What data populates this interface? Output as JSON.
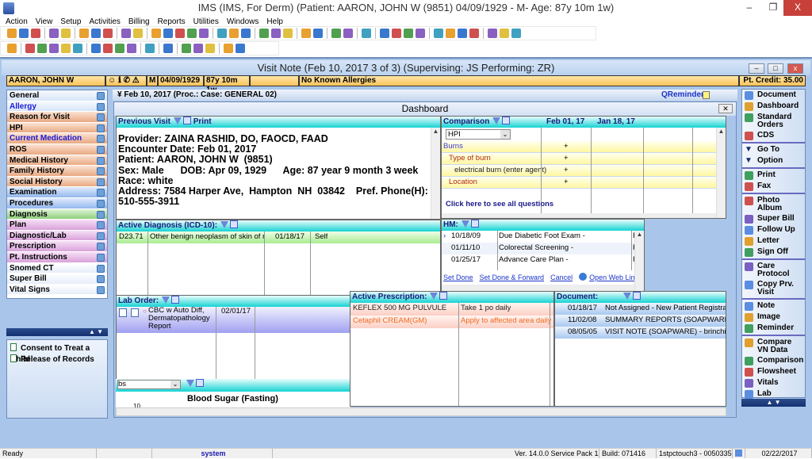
{
  "window": {
    "title": "IMS (IMS, For Derm)    (Patient: AARON, JOHN W (9851) 04/09/1929 - M- Age: 87y 10m 1w)",
    "minimize": "–",
    "restore": "❐",
    "close": "X"
  },
  "menu": [
    "Action",
    "View",
    "Setup",
    "Activities",
    "Billing",
    "Reports",
    "Utilities",
    "Windows",
    "Help"
  ],
  "toolbar1_icons": [
    "patient",
    "user",
    "user2",
    "|",
    "folder",
    "edit",
    "|",
    "lab",
    "flask",
    "shield",
    "|",
    "calendar",
    "notes",
    "|",
    "dollar",
    "refresh",
    "chart",
    "users",
    "globe",
    "|",
    "grid",
    "tools",
    "doc",
    "|",
    "arrow",
    "globe2",
    "globe3",
    "|",
    "folder2",
    "folder3",
    "|",
    "chart2",
    "person",
    "|",
    "clipboard",
    "|",
    "ins",
    "exchange",
    "word",
    "doc2",
    "|",
    "calc",
    "camera",
    "disc",
    "page",
    "|",
    "help",
    "lock",
    "exit"
  ],
  "toolbar2_icons": [
    "folder",
    "|",
    "plus",
    "edit",
    "minus",
    "pen",
    "heart",
    "|",
    "first",
    "prev",
    "next",
    "last",
    "|",
    "refresh",
    "|",
    "copy",
    "|",
    "check",
    "photo",
    "settings",
    "|",
    "help",
    "close"
  ],
  "visit_note": {
    "title": "Visit Note (Feb 10, 2017   3 of 3) (Supervising: JS Performing: ZR)"
  },
  "patient_bar": {
    "name": "AARON, JOHN W",
    "sex": "M",
    "dob": "04/09/1929",
    "age": "87y 10m 1w",
    "blank": "",
    "allergies": "No Known Allergies",
    "credit": "Pt. Credit: 35.00"
  },
  "left_nav": {
    "items": [
      {
        "label": "General",
        "group": "blue",
        "color": "#000000"
      },
      {
        "label": "Allergy",
        "group": "blue",
        "color": "#1a1ad8"
      },
      {
        "label": "Reason for Visit",
        "group": "orange",
        "color": "#000000"
      },
      {
        "label": "HPI",
        "group": "orange",
        "color": "#000000"
      },
      {
        "label": "Current Medication",
        "group": "orange",
        "color": "#1a1ad8"
      },
      {
        "label": "ROS",
        "group": "orange",
        "color": "#000000"
      },
      {
        "label": "Medical History",
        "group": "orange",
        "color": "#000000"
      },
      {
        "label": "Family History",
        "group": "orange",
        "color": "#000000"
      },
      {
        "label": "Social History",
        "group": "orange",
        "color": "#000000"
      },
      {
        "label": "Examination",
        "group": "exam",
        "color": "#000000"
      },
      {
        "label": "Procedures",
        "group": "exam",
        "color": "#000000"
      },
      {
        "label": "Diagnosis",
        "group": "green",
        "color": "#000000"
      },
      {
        "label": "Plan",
        "group": "pink",
        "color": "#000000"
      },
      {
        "label": "Diagnostic/Lab",
        "group": "pink",
        "color": "#000000"
      },
      {
        "label": "Prescription",
        "group": "pink",
        "color": "#000000"
      },
      {
        "label": "Pt. Instructions",
        "group": "pink",
        "color": "#000000"
      },
      {
        "label": "Snomed CT",
        "group": "white",
        "color": "#000000"
      },
      {
        "label": "Super Bill",
        "group": "white",
        "color": "#000000"
      },
      {
        "label": "Vital Signs",
        "group": "white",
        "color": "#000000"
      }
    ],
    "scroll": "▲ ▼",
    "links": [
      "Consent to Treat a Child",
      "Release of Records"
    ]
  },
  "case_strip": {
    "text": "Feb 10, 2017  (Proc.:   Case: GENERAL 02)",
    "qreminder": "QReminder"
  },
  "dashboard": {
    "title": "Dashboard",
    "close": "✕",
    "previous_visit": {
      "header": "Previous Visit",
      "print": "Print",
      "lines": [
        "Provider: ZAINA RASHID, DO, FAOCD, FAAD",
        "Encounter Date: Feb 01, 2017",
        "Patient: AARON, JOHN W  (9851)",
        "Sex: Male      DOB: Apr 09, 1929      Age: 87 year 9 month 3 week",
        "Race: white",
        "Address: 7584 Harper Ave,  Hampton  NH  03842    Pref. Phone(H):",
        "510-555-3911"
      ]
    },
    "comparison": {
      "header": "Comparison",
      "dates": [
        "Feb 01, 17",
        "Jan 18, 17"
      ],
      "select": "HPI",
      "rows": [
        {
          "label": "Burns",
          "value": "+",
          "color": "#3a3ad8",
          "indent": 0
        },
        {
          "label": "Type of burn",
          "value": "+",
          "color": "#b02a10",
          "indent": 1
        },
        {
          "label": "electrical burn (enter agent)",
          "value": "+",
          "color": "#222222",
          "indent": 2
        },
        {
          "label": "Location",
          "value": "+",
          "color": "#b02a10",
          "indent": 1
        }
      ],
      "see_all": "Click here to see all questions"
    },
    "hm": {
      "header": "HM:",
      "rows": [
        {
          "date": "10/18/09",
          "item": "Due Diabetic Foot Exam  -",
          "flag": "F",
          "current": true
        },
        {
          "date": "01/11/10",
          "item": "Colorectal Screening  -",
          "flag": "F"
        },
        {
          "date": "01/25/17",
          "item": "Advance Care Plan  -",
          "flag": "F"
        }
      ],
      "actions": [
        "Set Done",
        "Set Done & Forward",
        "Cancel",
        "Open Web Link"
      ]
    },
    "active_diagnosis": {
      "header": "Active Diagnosis (ICD-10):",
      "rows": [
        {
          "code": "D23.71",
          "desc": "Other benign neoplasm of skin of right lower limb",
          "date": "01/18/17",
          "by": "Self"
        }
      ]
    },
    "lab_order": {
      "header": "Lab Order:",
      "rows": [
        {
          "test": "CBC w Auto Diff, Dermatopathology Report",
          "date": "02/01/17"
        }
      ]
    },
    "active_prescription": {
      "header": "Active Prescription:",
      "rows": [
        {
          "drug": "KEFLEX 500 MG PULVULE",
          "sig": "Take 1 po daily",
          "color": "#222222"
        },
        {
          "drug": "Cetaphil   CREAM(GM)",
          "sig": "Apply to affected area daily",
          "color": "#f06a20"
        }
      ]
    },
    "document": {
      "header": "Document:",
      "rows": [
        {
          "date": "01/18/17",
          "desc": "Not Assigned - New Patient Registration"
        },
        {
          "date": "11/02/08",
          "desc": "SUMMARY REPORTS (SOAPWARE)  - Pa"
        },
        {
          "date": "08/05/05",
          "desc": "VISIT NOTE (SOAPWARE)  - brinchitis"
        }
      ]
    },
    "flowsheet": {
      "select": "bs",
      "chart_title": "Blood Sugar (Fasting)",
      "tick": "10"
    }
  },
  "right_nav": {
    "groups": [
      [
        "Document",
        "Dashboard",
        "Standard Orders",
        "CDS"
      ],
      [
        "Go To",
        "Option"
      ],
      [
        "Print",
        "Fax"
      ],
      [
        "Photo Album",
        "Super Bill",
        "Follow Up",
        "Letter",
        "Sign Off"
      ],
      [
        "Care Protocol",
        "Copy Prv. Visit"
      ],
      [
        "Note",
        "Image",
        "Reminder"
      ],
      [
        "Compare VN Data",
        "Comparison",
        "Flowsheet",
        "Vitals",
        "Lab"
      ]
    ],
    "scroll": "▲ ▼"
  },
  "status": {
    "ready": "Ready",
    "user": "system",
    "version": "Ver. 14.0.0 Service Pack 1",
    "build": "Build: 071416",
    "station": "1stpctouch3 - 0050335",
    "date": "02/22/2017"
  }
}
